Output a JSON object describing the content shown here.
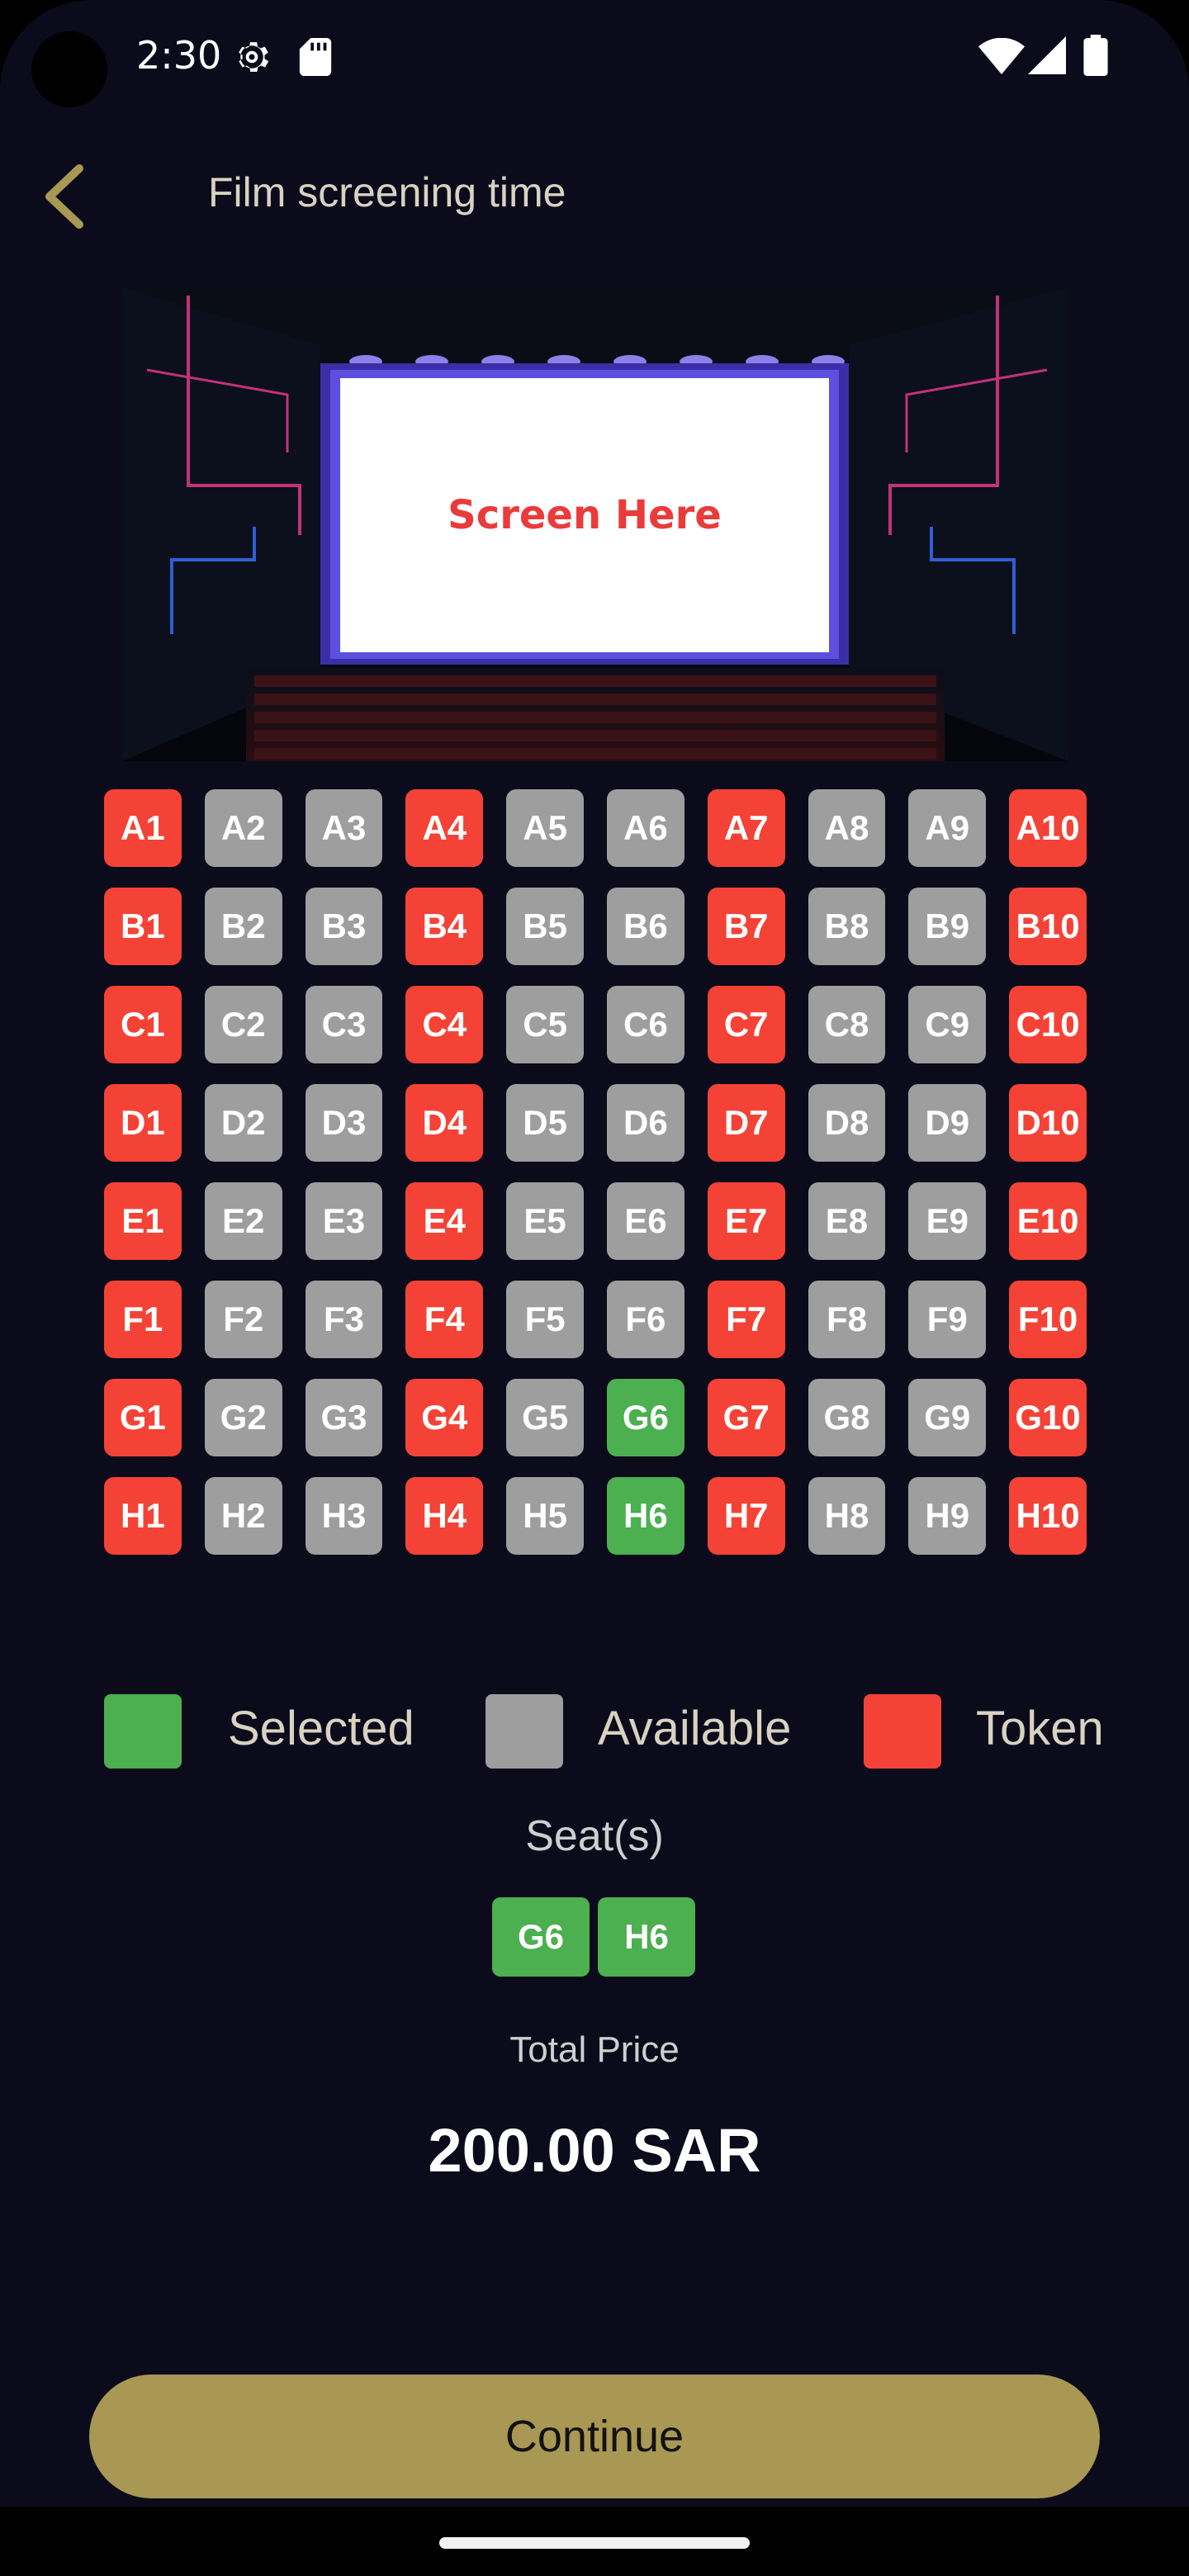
{
  "status_bar": {
    "time": "2:30",
    "icons": [
      "gear-icon",
      "sd-card-icon",
      "wifi-icon",
      "signal-icon",
      "battery-icon"
    ]
  },
  "header": {
    "back_icon": "chevron-left-icon",
    "title": "Film screening time"
  },
  "screen": {
    "label": "Screen Here"
  },
  "colors": {
    "background": "#0b0b1b",
    "token": "#f44336",
    "available": "#9e9e9e",
    "selected": "#4caf50",
    "accent": "#a99853"
  },
  "seat_rows": [
    {
      "row": "A",
      "seats": [
        {
          "label": "A1",
          "status": "token"
        },
        {
          "label": "A2",
          "status": "available"
        },
        {
          "label": "A3",
          "status": "available"
        },
        {
          "label": "A4",
          "status": "token"
        },
        {
          "label": "A5",
          "status": "available"
        },
        {
          "label": "A6",
          "status": "available"
        },
        {
          "label": "A7",
          "status": "token"
        },
        {
          "label": "A8",
          "status": "available"
        },
        {
          "label": "A9",
          "status": "available"
        },
        {
          "label": "A10",
          "status": "token"
        }
      ]
    },
    {
      "row": "B",
      "seats": [
        {
          "label": "B1",
          "status": "token"
        },
        {
          "label": "B2",
          "status": "available"
        },
        {
          "label": "B3",
          "status": "available"
        },
        {
          "label": "B4",
          "status": "token"
        },
        {
          "label": "B5",
          "status": "available"
        },
        {
          "label": "B6",
          "status": "available"
        },
        {
          "label": "B7",
          "status": "token"
        },
        {
          "label": "B8",
          "status": "available"
        },
        {
          "label": "B9",
          "status": "available"
        },
        {
          "label": "B10",
          "status": "token"
        }
      ]
    },
    {
      "row": "C",
      "seats": [
        {
          "label": "C1",
          "status": "token"
        },
        {
          "label": "C2",
          "status": "available"
        },
        {
          "label": "C3",
          "status": "available"
        },
        {
          "label": "C4",
          "status": "token"
        },
        {
          "label": "C5",
          "status": "available"
        },
        {
          "label": "C6",
          "status": "available"
        },
        {
          "label": "C7",
          "status": "token"
        },
        {
          "label": "C8",
          "status": "available"
        },
        {
          "label": "C9",
          "status": "available"
        },
        {
          "label": "C10",
          "status": "token"
        }
      ]
    },
    {
      "row": "D",
      "seats": [
        {
          "label": "D1",
          "status": "token"
        },
        {
          "label": "D2",
          "status": "available"
        },
        {
          "label": "D3",
          "status": "available"
        },
        {
          "label": "D4",
          "status": "token"
        },
        {
          "label": "D5",
          "status": "available"
        },
        {
          "label": "D6",
          "status": "available"
        },
        {
          "label": "D7",
          "status": "token"
        },
        {
          "label": "D8",
          "status": "available"
        },
        {
          "label": "D9",
          "status": "available"
        },
        {
          "label": "D10",
          "status": "token"
        }
      ]
    },
    {
      "row": "E",
      "seats": [
        {
          "label": "E1",
          "status": "token"
        },
        {
          "label": "E2",
          "status": "available"
        },
        {
          "label": "E3",
          "status": "available"
        },
        {
          "label": "E4",
          "status": "token"
        },
        {
          "label": "E5",
          "status": "available"
        },
        {
          "label": "E6",
          "status": "available"
        },
        {
          "label": "E7",
          "status": "token"
        },
        {
          "label": "E8",
          "status": "available"
        },
        {
          "label": "E9",
          "status": "available"
        },
        {
          "label": "E10",
          "status": "token"
        }
      ]
    },
    {
      "row": "F",
      "seats": [
        {
          "label": "F1",
          "status": "token"
        },
        {
          "label": "F2",
          "status": "available"
        },
        {
          "label": "F3",
          "status": "available"
        },
        {
          "label": "F4",
          "status": "token"
        },
        {
          "label": "F5",
          "status": "available"
        },
        {
          "label": "F6",
          "status": "available"
        },
        {
          "label": "F7",
          "status": "token"
        },
        {
          "label": "F8",
          "status": "available"
        },
        {
          "label": "F9",
          "status": "available"
        },
        {
          "label": "F10",
          "status": "token"
        }
      ]
    },
    {
      "row": "G",
      "seats": [
        {
          "label": "G1",
          "status": "token"
        },
        {
          "label": "G2",
          "status": "available"
        },
        {
          "label": "G3",
          "status": "available"
        },
        {
          "label": "G4",
          "status": "token"
        },
        {
          "label": "G5",
          "status": "available"
        },
        {
          "label": "G6",
          "status": "selected"
        },
        {
          "label": "G7",
          "status": "token"
        },
        {
          "label": "G8",
          "status": "available"
        },
        {
          "label": "G9",
          "status": "available"
        },
        {
          "label": "G10",
          "status": "token"
        }
      ]
    },
    {
      "row": "H",
      "seats": [
        {
          "label": "H1",
          "status": "token"
        },
        {
          "label": "H2",
          "status": "available"
        },
        {
          "label": "H3",
          "status": "available"
        },
        {
          "label": "H4",
          "status": "token"
        },
        {
          "label": "H5",
          "status": "available"
        },
        {
          "label": "H6",
          "status": "selected"
        },
        {
          "label": "H7",
          "status": "token"
        },
        {
          "label": "H8",
          "status": "available"
        },
        {
          "label": "H9",
          "status": "available"
        },
        {
          "label": "H10",
          "status": "token"
        }
      ]
    }
  ],
  "legend": {
    "selected": "Selected",
    "available": "Available",
    "token": "Token"
  },
  "summary": {
    "seats_label": "Seat(s)",
    "chosen_seats": [
      "G6",
      "H6"
    ],
    "total_label": "Total Price",
    "total_value": "200.00 SAR"
  },
  "actions": {
    "continue_label": "Continue"
  }
}
